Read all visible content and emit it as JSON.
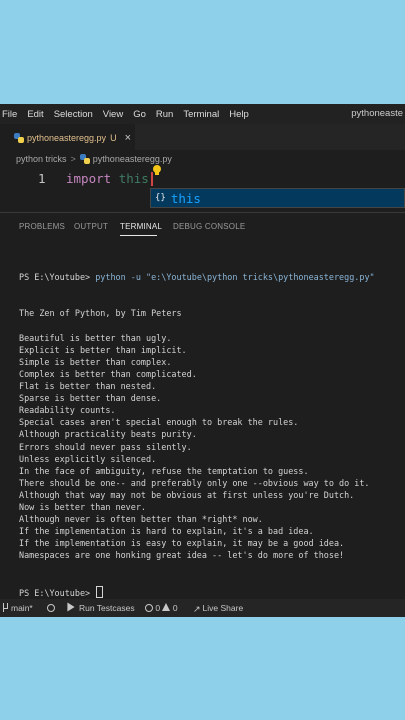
{
  "menubar": {
    "items": [
      "File",
      "Edit",
      "Selection",
      "View",
      "Go",
      "Run",
      "Terminal",
      "Help"
    ],
    "window_title": "pythoneaste"
  },
  "tabs": [
    {
      "label": "pythoneasteregg.py",
      "modified": "U",
      "close": "×"
    }
  ],
  "breadcrumb": {
    "folder": "python tricks",
    "separator": ">",
    "file": "pythoneasteregg.py"
  },
  "editor": {
    "line_number": "1",
    "keyword": "import",
    "module": "this",
    "suggestion": {
      "icon": "{}",
      "text": "this"
    }
  },
  "panel": {
    "tabs": [
      "PROBLEMS",
      "OUTPUT",
      "TERMINAL",
      "DEBUG CONSOLE"
    ],
    "active_tab": "TERMINAL"
  },
  "terminal": {
    "prompt": "PS E:\\Youtube>",
    "command": "python -u \"e:\\Youtube\\python tricks\\pythoneasteregg.py\"",
    "lines": [
      "The Zen of Python, by Tim Peters",
      "",
      "Beautiful is better than ugly.",
      "Explicit is better than implicit.",
      "Simple is better than complex.",
      "Complex is better than complicated.",
      "Flat is better than nested.",
      "Sparse is better than dense.",
      "Readability counts.",
      "Special cases aren't special enough to break the rules.",
      "Although practicality beats purity.",
      "Errors should never pass silently.",
      "Unless explicitly silenced.",
      "In the face of ambiguity, refuse the temptation to guess.",
      "There should be one-- and preferably only one --obvious way to do it.",
      "Although that way may not be obvious at first unless you're Dutch.",
      "Now is better than never.",
      "Although never is often better than *right* now.",
      "If the implementation is hard to explain, it's a bad idea.",
      "If the implementation is easy to explain, it may be a good idea.",
      "Namespaces are one honking great idea -- let's do more of those!"
    ],
    "final_prompt": "PS E:\\Youtube>"
  },
  "statusbar": {
    "branch": "main*",
    "run_testcases": "Run Testcases",
    "errors": "0",
    "warnings": "0",
    "live_share": "Live Share"
  },
  "colors": {
    "background_outer": "#8ed0ea",
    "editor_bg": "#1e1e1e",
    "keyword": "#c586c0",
    "suggestion_highlight": "#18a3ff",
    "tab_label": "#e2c08d"
  }
}
